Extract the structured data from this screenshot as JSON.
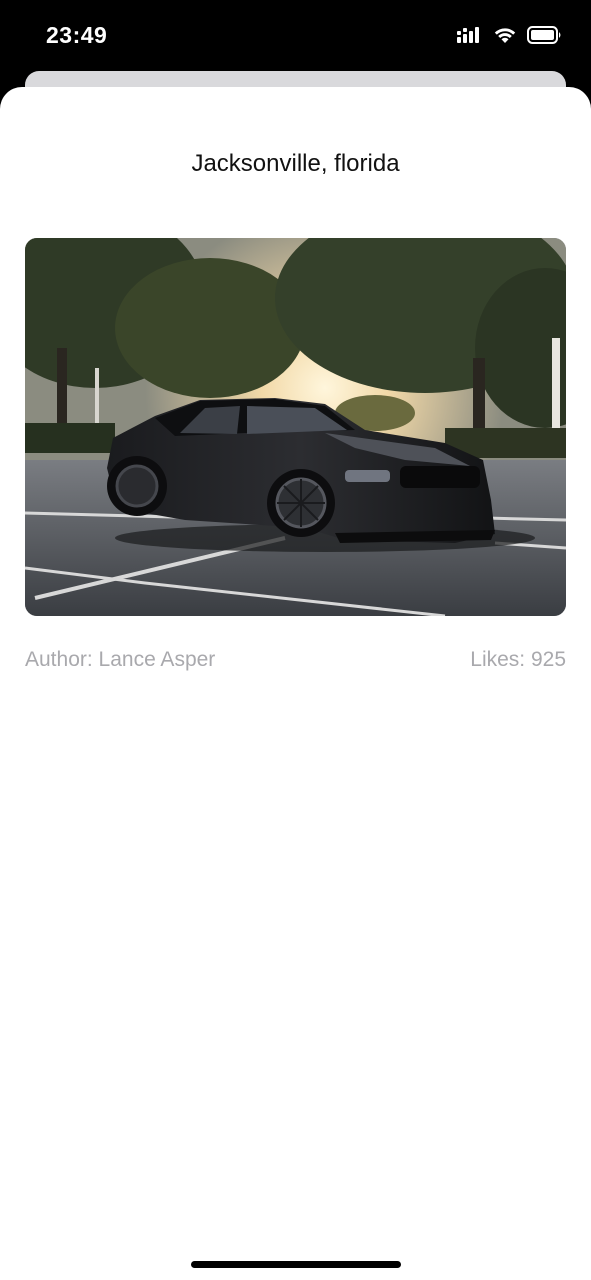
{
  "status_bar": {
    "time": "23:49",
    "icons": [
      "cellular-signal-icon",
      "wifi-icon",
      "battery-icon"
    ]
  },
  "detail": {
    "title": "Jacksonville, florida",
    "photo": {
      "subject": "black sports car in parking lot at sunset"
    },
    "author": "Author: Lance Asper",
    "likes": "Likes: 925"
  },
  "colors": {
    "sheet_background": "#ffffff",
    "title_text": "#111111",
    "meta_text": "#a9a9ad",
    "status_bar": "#000000"
  }
}
